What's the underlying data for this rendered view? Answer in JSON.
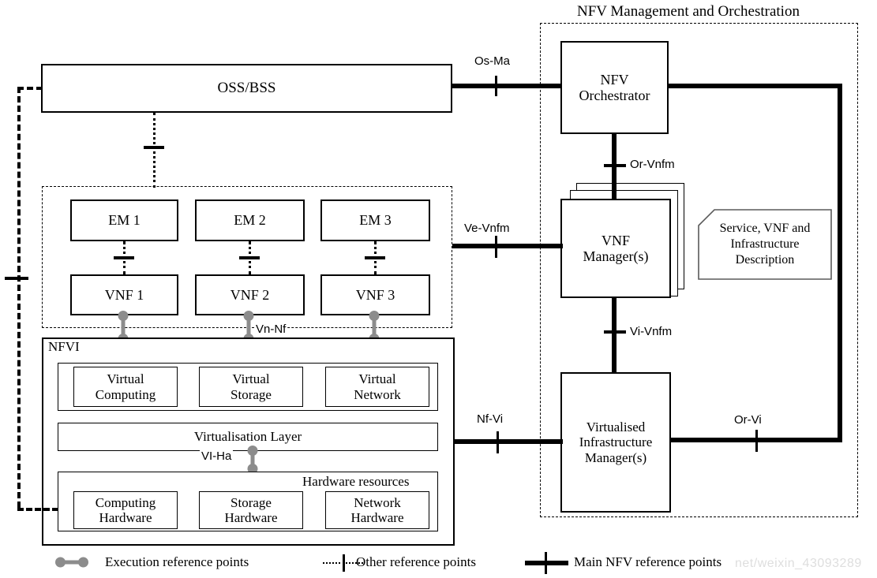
{
  "diagram": {
    "title": "NFV Management and Orchestration",
    "left_column": {
      "oss_bss": "OSS/BSS",
      "em_vnf_group": {
        "ems": [
          "EM 1",
          "EM 2",
          "EM 3"
        ],
        "vnfs": [
          "VNF 1",
          "VNF 2",
          "VNF 3"
        ]
      },
      "nfvi": {
        "label": "NFVI",
        "virtual_resources": [
          "Virtual\nComputing",
          "Virtual\nStorage",
          "Virtual\nNetwork"
        ],
        "virtual_computing": "Virtual Computing",
        "virtual_storage": "Virtual Storage",
        "virtual_network": "Virtual Network",
        "virtualisation_layer": "Virtualisation Layer",
        "hardware_resources_label": "Hardware resources",
        "computing_hardware": "Computing Hardware",
        "storage_hardware": "Storage Hardware",
        "network_hardware": "Network Hardware"
      }
    },
    "mano": {
      "orchestrator": "NFV Orchestrator",
      "orchestrator_line1": "NFV",
      "orchestrator_line2": "Orchestrator",
      "vnf_manager": "VNF Manager(s)",
      "vnf_manager_line1": "VNF",
      "vnf_manager_line2": "Manager(s)",
      "vim": "Virtualised Infrastructure Manager(s)",
      "vim_line1": "Virtualised",
      "vim_line2": "Infrastructure",
      "vim_line3": "Manager(s)",
      "description_doc": "Service, VNF and Infrastructure Description",
      "description_line1": "Service, VNF and",
      "description_line2": "Infrastructure",
      "description_line3": "Description"
    },
    "reference_points": {
      "os_ma": "Os-Ma",
      "ve_vnfm": "Ve-Vnfm",
      "nf_vi": "Nf-Vi",
      "or_vnfm": "Or-Vnfm",
      "vi_vnfm": "Vi-Vnfm",
      "or_vi": "Or-Vi",
      "vn_nf": "Vn-Nf",
      "vl_ha": "VI-Ha"
    },
    "legend": {
      "execution": "Execution reference points",
      "other": "Other reference points",
      "main": "Main NFV reference points"
    },
    "watermark": "net/weixin_43093289",
    "colors": {
      "line": "#000000",
      "execution_point": "#8c8c8c",
      "background": "#ffffff"
    }
  }
}
